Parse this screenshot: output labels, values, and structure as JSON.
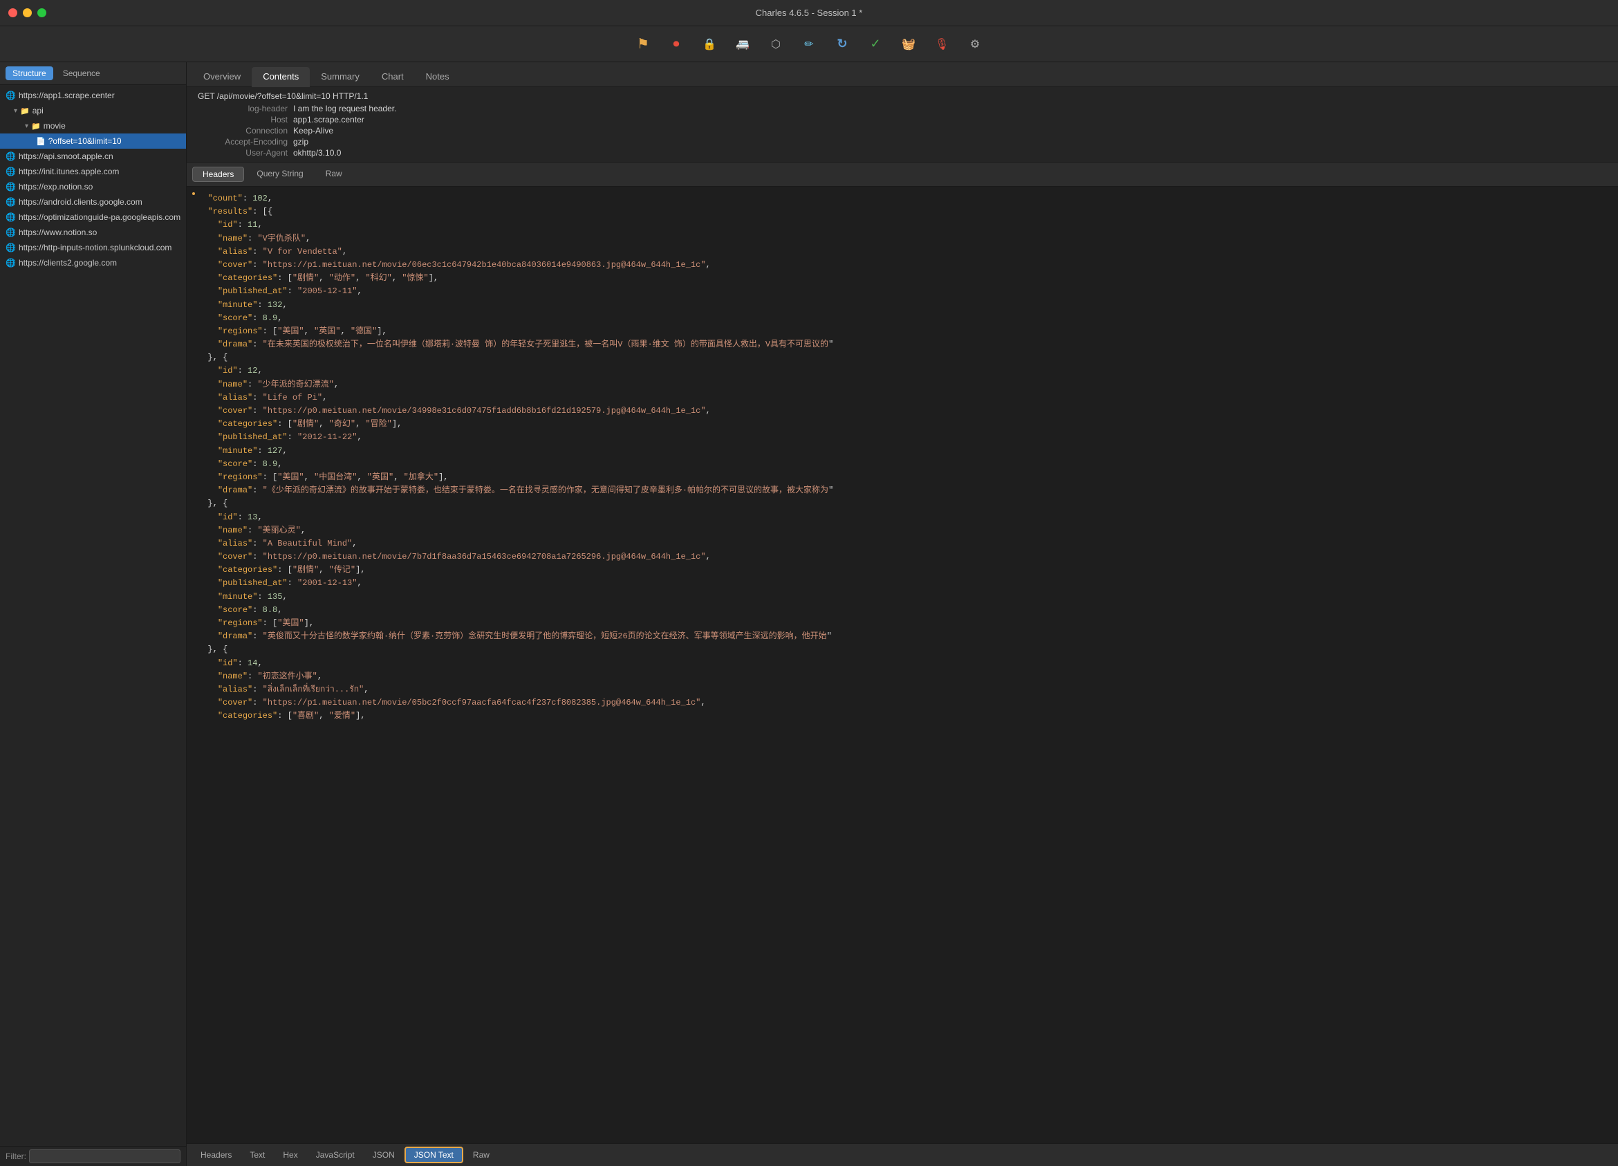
{
  "titlebar": {
    "title": "Charles 4.6.5 - Session 1 *"
  },
  "toolbar": {
    "icons": [
      {
        "name": "torch-icon",
        "symbol": "🔦"
      },
      {
        "name": "record-icon",
        "symbol": "⏺"
      },
      {
        "name": "lock-icon",
        "symbol": "🔒"
      },
      {
        "name": "throttle-icon",
        "symbol": "🚏"
      },
      {
        "name": "stop-icon",
        "symbol": "⬡"
      },
      {
        "name": "pen-icon",
        "symbol": "✒"
      },
      {
        "name": "refresh-icon",
        "symbol": "↻"
      },
      {
        "name": "check-icon",
        "symbol": "✓"
      },
      {
        "name": "basket-icon",
        "symbol": "🧺"
      },
      {
        "name": "mic-icon",
        "symbol": "🎙"
      },
      {
        "name": "gear-icon",
        "symbol": "⚙"
      }
    ]
  },
  "sidebar": {
    "tabs": [
      {
        "label": "Structure",
        "active": true
      },
      {
        "label": "Sequence",
        "active": false
      }
    ],
    "tree_items": [
      {
        "label": "https://app1.scrape.center",
        "type": "globe",
        "indent": 0,
        "selected": false
      },
      {
        "label": "api",
        "type": "folder",
        "indent": 1,
        "selected": false,
        "expanded": true
      },
      {
        "label": "movie",
        "type": "folder",
        "indent": 2,
        "selected": false,
        "expanded": true
      },
      {
        "label": "?offset=10&limit=10",
        "type": "file",
        "indent": 3,
        "selected": true
      },
      {
        "label": "https://api.smoot.apple.cn",
        "type": "globe",
        "indent": 0,
        "selected": false
      },
      {
        "label": "https://init.itunes.apple.com",
        "type": "globe",
        "indent": 0,
        "selected": false
      },
      {
        "label": "https://exp.notion.so",
        "type": "globe",
        "indent": 0,
        "selected": false
      },
      {
        "label": "https://android.clients.google.com",
        "type": "globe",
        "indent": 0,
        "selected": false
      },
      {
        "label": "https://optimizationguide-pa.googleapis.com",
        "type": "globe",
        "indent": 0,
        "selected": false
      },
      {
        "label": "https://www.notion.so",
        "type": "globe",
        "indent": 0,
        "selected": false
      },
      {
        "label": "https://http-inputs-notion.splunkcloud.com",
        "type": "globe",
        "indent": 0,
        "selected": false
      },
      {
        "label": "https://clients2.google.com",
        "type": "globe",
        "indent": 0,
        "selected": false
      }
    ],
    "filter_label": "Filter:"
  },
  "content": {
    "tabs": [
      {
        "label": "Overview",
        "active": false
      },
      {
        "label": "Contents",
        "active": true
      },
      {
        "label": "Summary",
        "active": false
      },
      {
        "label": "Chart",
        "active": false
      },
      {
        "label": "Notes",
        "active": false
      }
    ],
    "request_url": "GET /api/movie/?offset=10&limit=10 HTTP/1.1",
    "meta_fields": [
      {
        "key": "log-header",
        "value": "I am the log request header."
      },
      {
        "key": "Host",
        "value": "app1.scrape.center"
      },
      {
        "key": "Connection",
        "value": "Keep-Alive"
      },
      {
        "key": "Accept-Encoding",
        "value": "gzip"
      },
      {
        "key": "User-Agent",
        "value": "okhttp/3.10.0"
      }
    ],
    "sub_tabs": [
      {
        "label": "Headers",
        "active": true
      },
      {
        "label": "Query String",
        "active": false
      },
      {
        "label": "Raw",
        "active": false
      }
    ],
    "json_content": [
      {
        "text": "  \"count\": 102,",
        "type": "mixed"
      },
      {
        "text": "  \"results\": [{",
        "type": "mixed"
      },
      {
        "text": "    \"id\": 11,",
        "type": "mixed"
      },
      {
        "text": "    \"name\": \"V宇仇杀队\",",
        "type": "mixed"
      },
      {
        "text": "    \"alias\": \"V for Vendetta\",",
        "type": "mixed"
      },
      {
        "text": "    \"cover\": \"https://p1.meituan.net/movie/06ec3c1c647942b1e40bca84036014e9490863.jpg@464w_644h_1e_1c\",",
        "type": "mixed"
      },
      {
        "text": "    \"categories\": [\"剧情\", \"动作\", \"科幻\", \"惊悚\"],",
        "type": "mixed"
      },
      {
        "text": "    \"published_at\": \"2005-12-11\",",
        "type": "mixed"
      },
      {
        "text": "    \"minute\": 132,",
        "type": "mixed"
      },
      {
        "text": "    \"score\": 8.9,",
        "type": "mixed"
      },
      {
        "text": "    \"regions\": [\"美国\", \"英国\", \"德国\"],",
        "type": "mixed"
      },
      {
        "text": "    \"drama\": \"在未来英国的极权统治下，一位名叫伊维（娜塔莉·波特曼 饰）的年轻女子死里逃生，被一名叫V（雨果·维文 饰）的带面具怪人救出，V具有不可思议的",
        "type": "mixed"
      },
      {
        "text": "  }, {",
        "type": "mixed"
      },
      {
        "text": "    \"id\": 12,",
        "type": "mixed"
      },
      {
        "text": "    \"name\": \"少年派的奇幻漂流\",",
        "type": "mixed"
      },
      {
        "text": "    \"alias\": \"Life of Pi\",",
        "type": "mixed"
      },
      {
        "text": "    \"cover\": \"https://p0.meituan.net/movie/34998e31c6d07475f1add6b8b16fd21d192579.jpg@464w_644h_1e_1c\",",
        "type": "mixed"
      },
      {
        "text": "    \"categories\": [\"剧情\", \"奇幻\", \"冒险\"],",
        "type": "mixed"
      },
      {
        "text": "    \"published_at\": \"2012-11-22\",",
        "type": "mixed"
      },
      {
        "text": "    \"minute\": 127,",
        "type": "mixed"
      },
      {
        "text": "    \"score\": 8.9,",
        "type": "mixed"
      },
      {
        "text": "    \"regions\": [\"美国\", \"中国台湾\", \"英国\", \"加拿大\"],",
        "type": "mixed"
      },
      {
        "text": "    \"drama\": \"《少年派的奇幻漂流》的故事开始于蒙特娄，也结束于蒙特娄。一名在找寻灵感的作家，无意间得知了皮辛墨利多·帕帕尔的不可思议的故事，被大家称为",
        "type": "mixed"
      },
      {
        "text": "  }, {",
        "type": "mixed"
      },
      {
        "text": "    \"id\": 13,",
        "type": "mixed"
      },
      {
        "text": "    \"name\": \"美丽心灵\",",
        "type": "mixed"
      },
      {
        "text": "    \"alias\": \"A Beautiful Mind\",",
        "type": "mixed"
      },
      {
        "text": "    \"cover\": \"https://p0.meituan.net/movie/7b7d1f8aa36d7a15463ce6942708a1a7265296.jpg@464w_644h_1e_1c\",",
        "type": "mixed"
      },
      {
        "text": "    \"categories\": [\"剧情\", \"传记\"],",
        "type": "mixed"
      },
      {
        "text": "    \"published_at\": \"2001-12-13\",",
        "type": "mixed"
      },
      {
        "text": "    \"minute\": 135,",
        "type": "mixed"
      },
      {
        "text": "    \"score\": 8.8,",
        "type": "mixed"
      },
      {
        "text": "    \"regions\": [\"美国\"],",
        "type": "mixed"
      },
      {
        "text": "    \"drama\": \"英俊而又十分古怪的数学家约翰·纳什（罗素·克劳饰）念研究生时便发明了他的博弈理论，短短26页的论文在经济、军事等领域产生深远的影响，他开始",
        "type": "mixed"
      },
      {
        "text": "  }, {",
        "type": "mixed"
      },
      {
        "text": "    \"id\": 14,",
        "type": "mixed"
      },
      {
        "text": "    \"name\": \"初恋这件小事\",",
        "type": "mixed"
      },
      {
        "text": "    \"alias\": \"สิ่งเล็กเล็กที่เรียกว่า...รัก\",",
        "type": "mixed"
      },
      {
        "text": "    \"cover\": \"https://p1.meituan.net/movie/05bc2f0ccf97aacfa64fcac4f237cf8082385.jpg@464w_644h_1e_1c\",",
        "type": "mixed"
      },
      {
        "text": "    \"categories\": [\"喜剧\", \"爱情\"],",
        "type": "mixed"
      }
    ]
  },
  "bottom_tabs": [
    {
      "label": "Headers",
      "active": false
    },
    {
      "label": "Text",
      "active": false
    },
    {
      "label": "Hex",
      "active": false
    },
    {
      "label": "JavaScript",
      "active": false
    },
    {
      "label": "JSON",
      "active": false
    },
    {
      "label": "JSON Text",
      "active": true
    },
    {
      "label": "Raw",
      "active": false
    }
  ]
}
